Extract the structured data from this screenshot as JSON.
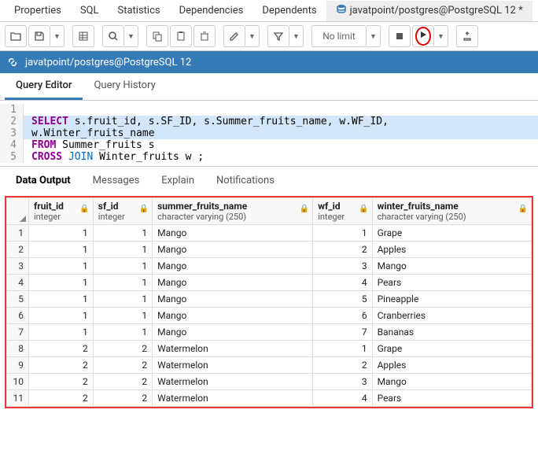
{
  "topTabs": {
    "properties": "Properties",
    "sql": "SQL",
    "statistics": "Statistics",
    "dependencies": "Dependencies",
    "dependents": "Dependents",
    "active": "javatpoint/postgres@PostgreSQL 12 *"
  },
  "toolbar": {
    "nolimit": "No limit"
  },
  "connBar": {
    "label": "javatpoint/postgres@PostgreSQL 12"
  },
  "editorTabs": {
    "queryEditor": "Query Editor",
    "queryHistory": "Query History"
  },
  "code": {
    "l1": "",
    "l2_kw": "SELECT",
    "l2_rest": " s.fruit_id, s.SF_ID, s.Summer_fruits_name, w.WF_ID,",
    "l3": "w.Winter_fruits_name",
    "l4_kw": "FROM",
    "l4_rest": " Summer_fruits s",
    "l5_a": "CROSS",
    "l5_b": "JOIN",
    "l5_rest": " Winter_fruits w ;"
  },
  "resultTabs": {
    "dataOutput": "Data Output",
    "messages": "Messages",
    "explain": "Explain",
    "notifications": "Notifications"
  },
  "columns": [
    {
      "name": "fruit_id",
      "type": "integer"
    },
    {
      "name": "sf_id",
      "type": "integer"
    },
    {
      "name": "summer_fruits_name",
      "type": "character varying (250)"
    },
    {
      "name": "wf_id",
      "type": "integer"
    },
    {
      "name": "winter_fruits_name",
      "type": "character varying (250)"
    }
  ],
  "rows": [
    {
      "n": "1",
      "fruit_id": "1",
      "sf_id": "1",
      "sfn": "Mango",
      "wf_id": "1",
      "wfn": "Grape"
    },
    {
      "n": "2",
      "fruit_id": "1",
      "sf_id": "1",
      "sfn": "Mango",
      "wf_id": "2",
      "wfn": "Apples"
    },
    {
      "n": "3",
      "fruit_id": "1",
      "sf_id": "1",
      "sfn": "Mango",
      "wf_id": "3",
      "wfn": "Mango"
    },
    {
      "n": "4",
      "fruit_id": "1",
      "sf_id": "1",
      "sfn": "Mango",
      "wf_id": "4",
      "wfn": "Pears"
    },
    {
      "n": "5",
      "fruit_id": "1",
      "sf_id": "1",
      "sfn": "Mango",
      "wf_id": "5",
      "wfn": "Pineapple"
    },
    {
      "n": "6",
      "fruit_id": "1",
      "sf_id": "1",
      "sfn": "Mango",
      "wf_id": "6",
      "wfn": "Cranberries"
    },
    {
      "n": "7",
      "fruit_id": "1",
      "sf_id": "1",
      "sfn": "Mango",
      "wf_id": "7",
      "wfn": "Bananas"
    },
    {
      "n": "8",
      "fruit_id": "2",
      "sf_id": "2",
      "sfn": "Watermelon",
      "wf_id": "1",
      "wfn": "Grape"
    },
    {
      "n": "9",
      "fruit_id": "2",
      "sf_id": "2",
      "sfn": "Watermelon",
      "wf_id": "2",
      "wfn": "Apples"
    },
    {
      "n": "10",
      "fruit_id": "2",
      "sf_id": "2",
      "sfn": "Watermelon",
      "wf_id": "3",
      "wfn": "Mango"
    },
    {
      "n": "11",
      "fruit_id": "2",
      "sf_id": "2",
      "sfn": "Watermelon",
      "wf_id": "4",
      "wfn": "Pears"
    }
  ]
}
